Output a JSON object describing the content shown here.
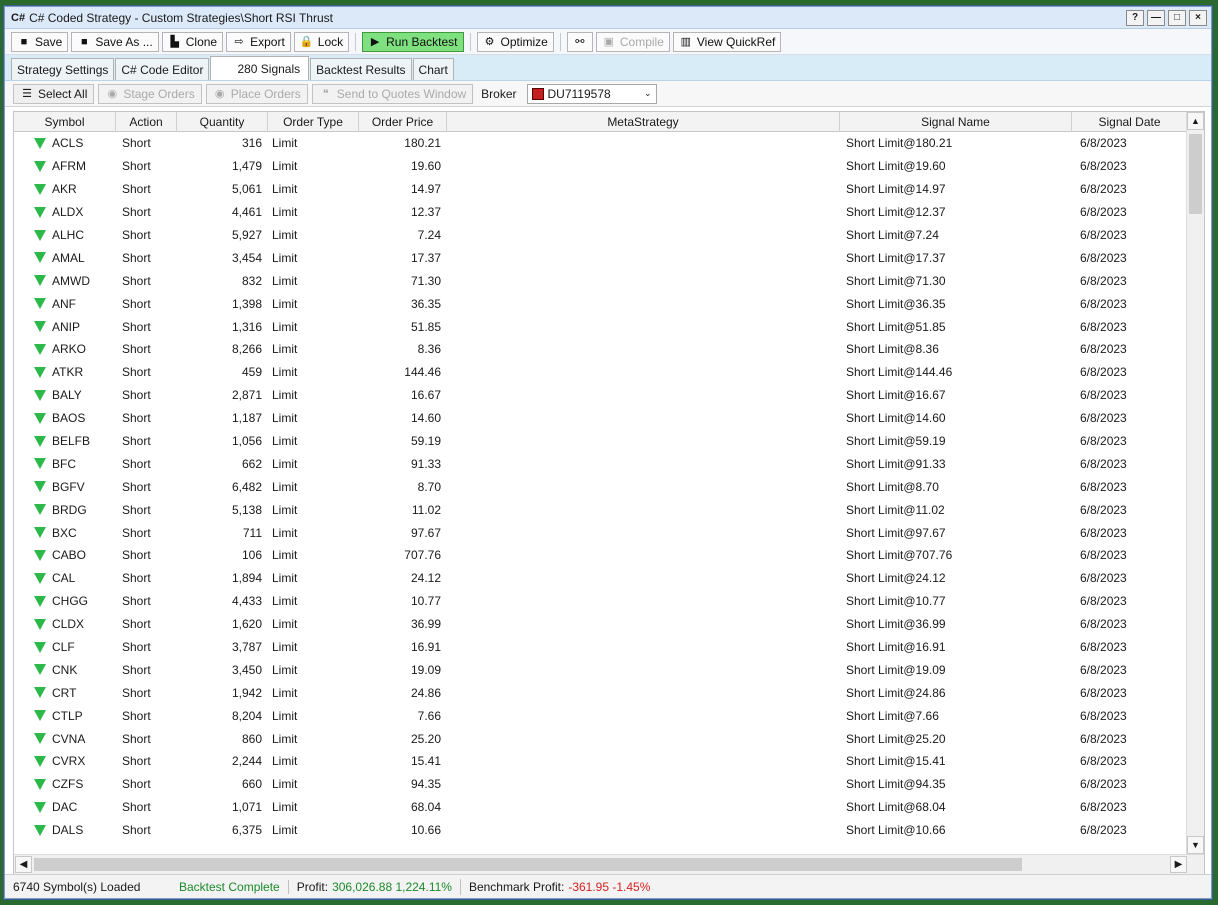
{
  "window": {
    "icon": "C#",
    "title": "C# Coded Strategy - Custom Strategies\\Short RSI Thrust",
    "controls": [
      "?",
      "—",
      "□",
      "×"
    ]
  },
  "toolbar": {
    "save": "Save",
    "save_as": "Save As ...",
    "clone": "Clone",
    "export": "Export",
    "lock": "Lock",
    "run_backtest": "Run Backtest",
    "optimize": "Optimize",
    "compile": "Compile",
    "view_quickref": "View QuickRef"
  },
  "tabs": [
    "Strategy Settings",
    "C# Code Editor",
    "280 Signals",
    "Backtest Results",
    "Chart"
  ],
  "actions": {
    "select_all": "Select All",
    "stage_orders": "Stage Orders",
    "place_orders": "Place Orders",
    "send_quotes": "Send to Quotes Window",
    "broker_label": "Broker",
    "broker_value": "DU7119578"
  },
  "columns": {
    "symbol": "Symbol",
    "action": "Action",
    "quantity": "Quantity",
    "order_type": "Order Type",
    "order_price": "Order Price",
    "metastrategy": "MetaStrategy",
    "signal_name": "Signal Name",
    "signal_date": "Signal Date"
  },
  "rows": [
    {
      "symbol": "ACLS",
      "action": "Short",
      "qty": "316",
      "type": "Limit",
      "price": "180.21",
      "signal": "Short Limit@180.21",
      "date": "6/8/2023"
    },
    {
      "symbol": "AFRM",
      "action": "Short",
      "qty": "1,479",
      "type": "Limit",
      "price": "19.60",
      "signal": "Short Limit@19.60",
      "date": "6/8/2023"
    },
    {
      "symbol": "AKR",
      "action": "Short",
      "qty": "5,061",
      "type": "Limit",
      "price": "14.97",
      "signal": "Short Limit@14.97",
      "date": "6/8/2023"
    },
    {
      "symbol": "ALDX",
      "action": "Short",
      "qty": "4,461",
      "type": "Limit",
      "price": "12.37",
      "signal": "Short Limit@12.37",
      "date": "6/8/2023"
    },
    {
      "symbol": "ALHC",
      "action": "Short",
      "qty": "5,927",
      "type": "Limit",
      "price": "7.24",
      "signal": "Short Limit@7.24",
      "date": "6/8/2023"
    },
    {
      "symbol": "AMAL",
      "action": "Short",
      "qty": "3,454",
      "type": "Limit",
      "price": "17.37",
      "signal": "Short Limit@17.37",
      "date": "6/8/2023"
    },
    {
      "symbol": "AMWD",
      "action": "Short",
      "qty": "832",
      "type": "Limit",
      "price": "71.30",
      "signal": "Short Limit@71.30",
      "date": "6/8/2023"
    },
    {
      "symbol": "ANF",
      "action": "Short",
      "qty": "1,398",
      "type": "Limit",
      "price": "36.35",
      "signal": "Short Limit@36.35",
      "date": "6/8/2023"
    },
    {
      "symbol": "ANIP",
      "action": "Short",
      "qty": "1,316",
      "type": "Limit",
      "price": "51.85",
      "signal": "Short Limit@51.85",
      "date": "6/8/2023"
    },
    {
      "symbol": "ARKO",
      "action": "Short",
      "qty": "8,266",
      "type": "Limit",
      "price": "8.36",
      "signal": "Short Limit@8.36",
      "date": "6/8/2023"
    },
    {
      "symbol": "ATKR",
      "action": "Short",
      "qty": "459",
      "type": "Limit",
      "price": "144.46",
      "signal": "Short Limit@144.46",
      "date": "6/8/2023"
    },
    {
      "symbol": "BALY",
      "action": "Short",
      "qty": "2,871",
      "type": "Limit",
      "price": "16.67",
      "signal": "Short Limit@16.67",
      "date": "6/8/2023"
    },
    {
      "symbol": "BAOS",
      "action": "Short",
      "qty": "1,187",
      "type": "Limit",
      "price": "14.60",
      "signal": "Short Limit@14.60",
      "date": "6/8/2023"
    },
    {
      "symbol": "BELFB",
      "action": "Short",
      "qty": "1,056",
      "type": "Limit",
      "price": "59.19",
      "signal": "Short Limit@59.19",
      "date": "6/8/2023"
    },
    {
      "symbol": "BFC",
      "action": "Short",
      "qty": "662",
      "type": "Limit",
      "price": "91.33",
      "signal": "Short Limit@91.33",
      "date": "6/8/2023"
    },
    {
      "symbol": "BGFV",
      "action": "Short",
      "qty": "6,482",
      "type": "Limit",
      "price": "8.70",
      "signal": "Short Limit@8.70",
      "date": "6/8/2023"
    },
    {
      "symbol": "BRDG",
      "action": "Short",
      "qty": "5,138",
      "type": "Limit",
      "price": "11.02",
      "signal": "Short Limit@11.02",
      "date": "6/8/2023"
    },
    {
      "symbol": "BXC",
      "action": "Short",
      "qty": "711",
      "type": "Limit",
      "price": "97.67",
      "signal": "Short Limit@97.67",
      "date": "6/8/2023"
    },
    {
      "symbol": "CABO",
      "action": "Short",
      "qty": "106",
      "type": "Limit",
      "price": "707.76",
      "signal": "Short Limit@707.76",
      "date": "6/8/2023"
    },
    {
      "symbol": "CAL",
      "action": "Short",
      "qty": "1,894",
      "type": "Limit",
      "price": "24.12",
      "signal": "Short Limit@24.12",
      "date": "6/8/2023"
    },
    {
      "symbol": "CHGG",
      "action": "Short",
      "qty": "4,433",
      "type": "Limit",
      "price": "10.77",
      "signal": "Short Limit@10.77",
      "date": "6/8/2023"
    },
    {
      "symbol": "CLDX",
      "action": "Short",
      "qty": "1,620",
      "type": "Limit",
      "price": "36.99",
      "signal": "Short Limit@36.99",
      "date": "6/8/2023"
    },
    {
      "symbol": "CLF",
      "action": "Short",
      "qty": "3,787",
      "type": "Limit",
      "price": "16.91",
      "signal": "Short Limit@16.91",
      "date": "6/8/2023"
    },
    {
      "symbol": "CNK",
      "action": "Short",
      "qty": "3,450",
      "type": "Limit",
      "price": "19.09",
      "signal": "Short Limit@19.09",
      "date": "6/8/2023"
    },
    {
      "symbol": "CRT",
      "action": "Short",
      "qty": "1,942",
      "type": "Limit",
      "price": "24.86",
      "signal": "Short Limit@24.86",
      "date": "6/8/2023"
    },
    {
      "symbol": "CTLP",
      "action": "Short",
      "qty": "8,204",
      "type": "Limit",
      "price": "7.66",
      "signal": "Short Limit@7.66",
      "date": "6/8/2023"
    },
    {
      "symbol": "CVNA",
      "action": "Short",
      "qty": "860",
      "type": "Limit",
      "price": "25.20",
      "signal": "Short Limit@25.20",
      "date": "6/8/2023"
    },
    {
      "symbol": "CVRX",
      "action": "Short",
      "qty": "2,244",
      "type": "Limit",
      "price": "15.41",
      "signal": "Short Limit@15.41",
      "date": "6/8/2023"
    },
    {
      "symbol": "CZFS",
      "action": "Short",
      "qty": "660",
      "type": "Limit",
      "price": "94.35",
      "signal": "Short Limit@94.35",
      "date": "6/8/2023"
    },
    {
      "symbol": "DAC",
      "action": "Short",
      "qty": "1,071",
      "type": "Limit",
      "price": "68.04",
      "signal": "Short Limit@68.04",
      "date": "6/8/2023"
    },
    {
      "symbol": "DALS",
      "action": "Short",
      "qty": "6,375",
      "type": "Limit",
      "price": "10.66",
      "signal": "Short Limit@10.66",
      "date": "6/8/2023"
    }
  ],
  "status": {
    "loaded": "6740 Symbol(s) Loaded",
    "backtest": "Backtest Complete",
    "profit_label": "Profit:",
    "profit_value": "306,026.88 1,224.11%",
    "benchmark_label": "Benchmark Profit:",
    "benchmark_value": "-361.95 -1.45%"
  },
  "colors": {
    "run_button": "#7ee07e",
    "signal_triangle": "#2db84a",
    "profit_green": "#1b8a2a",
    "benchmark_red": "#d62020",
    "tab_strip": "#d7ecf7"
  }
}
